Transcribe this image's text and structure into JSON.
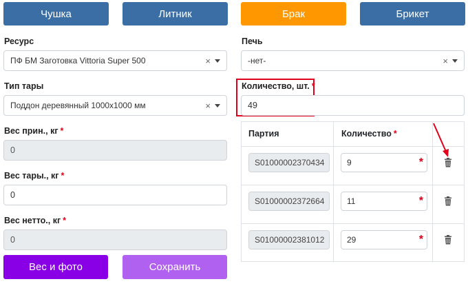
{
  "tabs": [
    {
      "label": "Чушка",
      "color": "#3a6ea5"
    },
    {
      "label": "Литник",
      "color": "#3a6ea5"
    },
    {
      "label": "Брак",
      "color": "#ff9800"
    },
    {
      "label": "Брикет",
      "color": "#3a6ea5"
    }
  ],
  "resource": {
    "label": "Ресурс",
    "value": "ПФ БМ Заготовка Vittoria Super 500"
  },
  "furnace": {
    "label": "Печь",
    "value": "-нет-"
  },
  "container_type": {
    "label": "Тип тары",
    "value": "Поддон деревянный 1000x1000 мм"
  },
  "quantity": {
    "label": "Количество, шт.",
    "required_mark": "*",
    "value": "49"
  },
  "gross_weight": {
    "label": "Вес прин., кг",
    "required_mark": "*",
    "value": "0"
  },
  "tare_weight": {
    "label": "Вес тары., кг",
    "required_mark": "*",
    "value": "0"
  },
  "net_weight": {
    "label": "Вес нетто., кг",
    "required_mark": "*",
    "value": "0"
  },
  "table": {
    "headers": {
      "batch": "Партия",
      "quantity": "Количество",
      "required_mark": "*"
    },
    "rows": [
      {
        "batch": "S01000002370434",
        "quantity": "9"
      },
      {
        "batch": "S01000002372664",
        "quantity": "11"
      },
      {
        "batch": "S01000002381012",
        "quantity": "29"
      }
    ]
  },
  "buttons": {
    "weigh_photo": {
      "label": "Вес и фото",
      "color": "#8a00e6"
    },
    "save": {
      "label": "Сохранить",
      "color": "#b061f0"
    }
  },
  "clear_glyph": "×",
  "accent_red": "#e0001b"
}
